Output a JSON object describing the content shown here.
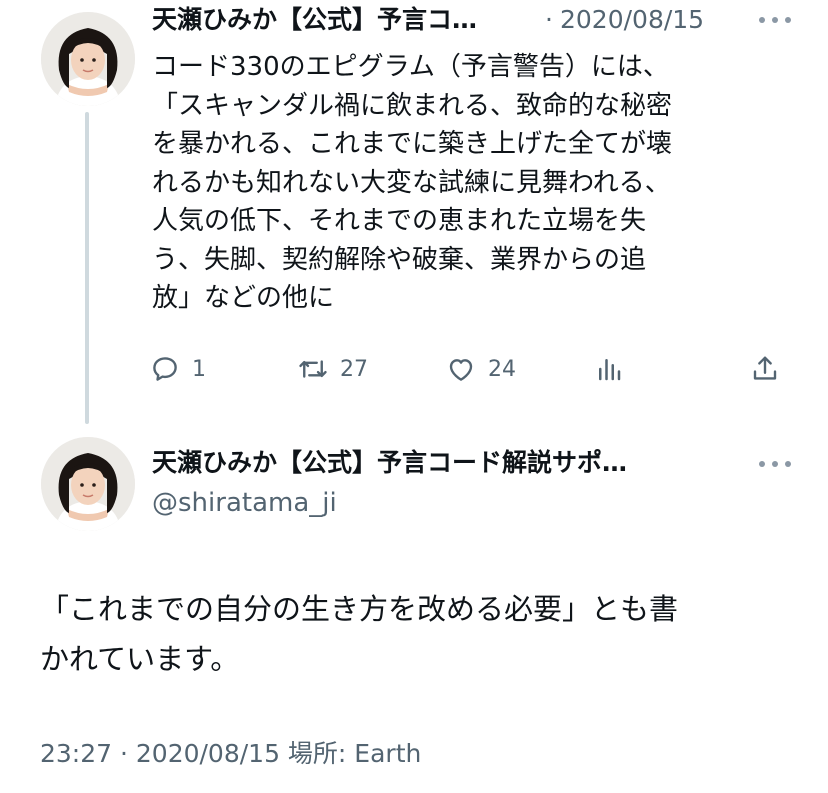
{
  "reply_tweet": {
    "author_name": "天瀬ひみか【公式】予言コ…",
    "separator": "·",
    "date": "2020/08/15",
    "more_icon": "more-horizontal-icon",
    "body_lines": [
      "コード330のエピグラム（予言警告）には、",
      "「スキャンダル禍に飲まれる、致命的な秘密",
      "を暴かれる、これまでに築き上げた全てが壊",
      "れるかも知れない大変な試練に見舞われる、",
      "人気の低下、それまでの恵まれた立場を失",
      "う、失脚、契約解除や破棄、業界からの追",
      "放」などの他に"
    ],
    "actions": {
      "reply": {
        "icon": "reply-icon",
        "count": "1"
      },
      "retweet": {
        "icon": "retweet-icon",
        "count": "27"
      },
      "like": {
        "icon": "heart-icon",
        "count": "24"
      },
      "analytics": {
        "icon": "analytics-icon"
      },
      "share": {
        "icon": "share-icon"
      }
    }
  },
  "main_tweet": {
    "author_name": "天瀬ひみか【公式】予言コード解説サポ…",
    "handle": "@shiratama_ji",
    "more_icon": "more-horizontal-icon",
    "body_lines": [
      "「これまでの自分の生き方を改める必要」とも書",
      "かれています。"
    ],
    "timestamp": "23:27 · 2020/08/15 場所: Earth"
  },
  "colors": {
    "text_primary": "#0f1419",
    "text_secondary": "#536471",
    "thread_line": "#cfd9de",
    "more_dots": "#8b98a5"
  }
}
